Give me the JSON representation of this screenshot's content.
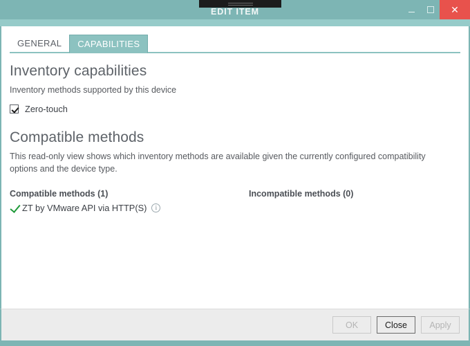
{
  "window": {
    "title": "EDIT ITEM",
    "accent_color": "#7db5b4",
    "close_color": "#e8524c",
    "controls": {
      "minimize_label": "_",
      "maximize_label": "□",
      "close_label": "✕"
    }
  },
  "tabs": [
    {
      "label": "GENERAL",
      "active": false
    },
    {
      "label": "CAPABILITIES",
      "active": true
    }
  ],
  "sections": {
    "inventory": {
      "title": "Inventory capabilities",
      "description": "Inventory methods supported by this device",
      "checkbox": {
        "label": "Zero-touch",
        "checked": true
      }
    },
    "compatible": {
      "title": "Compatible methods",
      "description": "This read-only view shows which inventory methods are available given the currently configured compatibility options and the device type."
    }
  },
  "methods": {
    "compatible": {
      "heading": "Compatible methods (1)",
      "count": 1,
      "items": [
        {
          "label": "ZT by VMware API via HTTP(S)",
          "status_icon": "check-icon",
          "status_color": "#1e9938",
          "info_icon": "info-icon",
          "info_glyph": "i"
        }
      ]
    },
    "incompatible": {
      "heading": "Incompatible methods (0)",
      "count": 0,
      "items": []
    }
  },
  "footer": {
    "buttons": [
      {
        "label": "OK",
        "enabled": false
      },
      {
        "label": "Close",
        "enabled": true
      },
      {
        "label": "Apply",
        "enabled": false
      }
    ]
  }
}
